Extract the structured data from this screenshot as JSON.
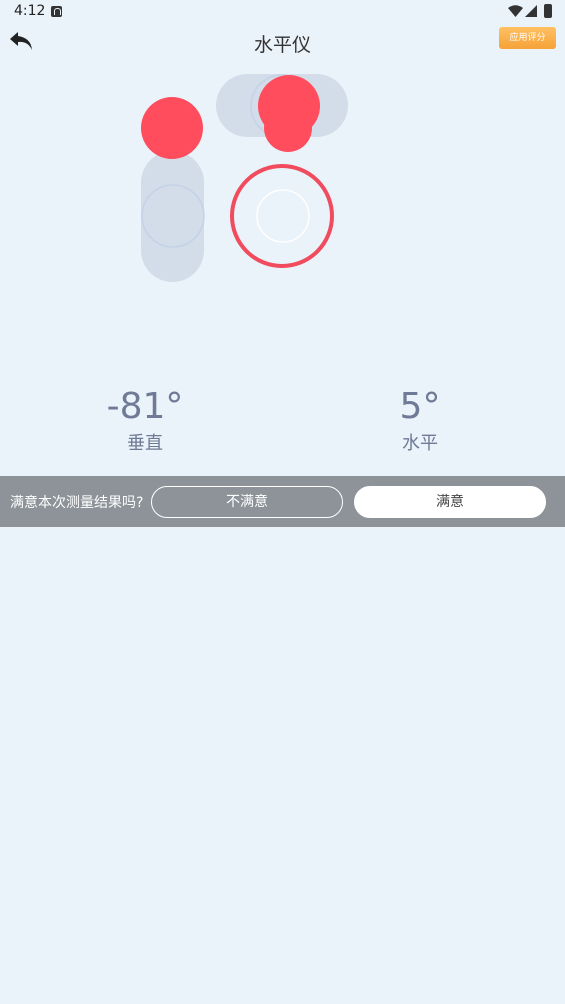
{
  "status_bar": {
    "time": "4:12",
    "icons": [
      "notification-icon",
      "wifi-icon",
      "signal-icon",
      "battery-icon"
    ]
  },
  "header": {
    "title": "水平仪",
    "back_icon": "back-arrow-icon",
    "rate_button_label": "应用评分"
  },
  "level": {
    "bubble_color": "#ff4d5e",
    "tube_color": "#d3dde9"
  },
  "readouts": {
    "vertical_value": "-81°",
    "vertical_label": "垂直",
    "horizontal_value": "5°",
    "horizontal_label": "水平"
  },
  "feedback": {
    "question": "满意本次测量结果吗?",
    "unsatisfied_label": "不满意",
    "satisfied_label": "满意"
  }
}
